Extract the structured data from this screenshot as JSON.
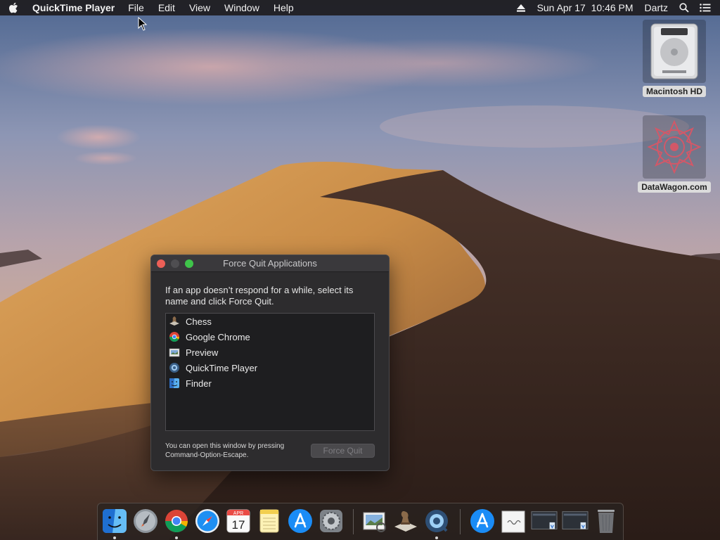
{
  "menubar": {
    "app_name": "QuickTime Player",
    "menus": [
      "File",
      "Edit",
      "View",
      "Window",
      "Help"
    ],
    "date_time": "Sun Apr 17  10:46 PM",
    "user": "Dartz",
    "icons": [
      "apple-icon",
      "eject-icon",
      "spotlight-search-icon",
      "notification-center-icon"
    ]
  },
  "desktop_icons": [
    {
      "label": "Macintosh HD",
      "icon": "hard-drive-icon"
    },
    {
      "label": "DataWagon.com",
      "icon": "mandala-disk-image-icon"
    }
  ],
  "force_quit": {
    "title": "Force Quit Applications",
    "description": "If an app doesn’t respond for a while, select its name and click Force Quit.",
    "apps": [
      {
        "name": "Chess",
        "icon": "chess-icon"
      },
      {
        "name": "Google Chrome",
        "icon": "chrome-icon"
      },
      {
        "name": "Preview",
        "icon": "preview-icon"
      },
      {
        "name": "QuickTime Player",
        "icon": "quicktime-icon"
      },
      {
        "name": "Finder",
        "icon": "finder-icon"
      }
    ],
    "hint": "You can open this window by pressing Command-Option-Escape.",
    "button_label": "Force Quit",
    "button_enabled": false
  },
  "dock": {
    "items": [
      {
        "icon": "finder-icon",
        "running": true
      },
      {
        "icon": "launchpad-icon",
        "running": false
      },
      {
        "icon": "chrome-icon",
        "running": true
      },
      {
        "icon": "safari-icon",
        "running": false
      },
      {
        "icon": "calendar-icon",
        "running": false,
        "month": "APR",
        "day": "17"
      },
      {
        "icon": "notes-icon",
        "running": false
      },
      {
        "icon": "app-store-icon",
        "running": false
      },
      {
        "icon": "system-preferences-icon",
        "running": false
      },
      {
        "icon": "preview-icon",
        "running": false
      },
      {
        "icon": "chess-icon",
        "running": false
      },
      {
        "icon": "quicktime-icon",
        "running": true
      },
      {
        "icon": "downloads-app-store-icon",
        "running": false
      },
      {
        "icon": "document-stack-icon",
        "running": false
      },
      {
        "icon": "screenshot-stack-icon",
        "running": false
      },
      {
        "icon": "screenshot-stack-2-icon",
        "running": false
      },
      {
        "icon": "trash-icon",
        "running": false
      }
    ]
  },
  "colors": {
    "menubar_bg": "#1e1c1e",
    "window_bg": "#2d2c2e",
    "close_button": "#ec5f57",
    "zoom_button": "#3fc44a",
    "dune_light": "#d49a52",
    "dune_dark": "#3b2a22"
  }
}
